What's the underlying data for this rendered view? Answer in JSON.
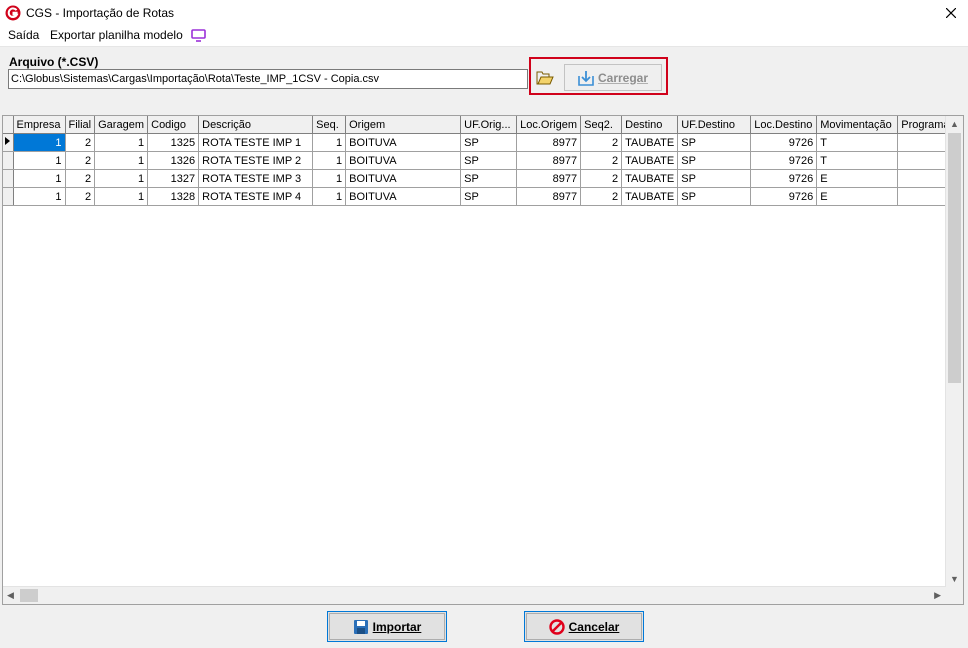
{
  "window": {
    "title": "CGS - Importação de Rotas"
  },
  "menu": {
    "items": [
      "Saída",
      "Exportar planilha modelo"
    ]
  },
  "file": {
    "label": "Arquivo (*.CSV)",
    "path": "C:\\Globus\\Sistemas\\Cargas\\Importação\\Rota\\Teste_IMP_1CSV - Copia.csv"
  },
  "load_button": {
    "label": "Carregar",
    "accent": "#d0021b"
  },
  "grid": {
    "columns": [
      "Empresa",
      "Filial",
      "Garagem",
      "Codigo",
      "Descrição",
      "Seq.",
      "Origem",
      "UF.Orig...",
      "Loc.Origem",
      "Seq2.",
      "Destino",
      "UF.Destino",
      "Loc.Destino",
      "Movimentação",
      "Programaç"
    ],
    "rows": [
      [
        "1",
        "2",
        "1",
        "1325",
        "ROTA TESTE IMP 1",
        "1",
        "BOITUVA",
        "SP",
        "8977",
        "2",
        "TAUBATE",
        "SP",
        "9726",
        "T",
        ""
      ],
      [
        "1",
        "2",
        "1",
        "1326",
        "ROTA TESTE IMP 2",
        "1",
        "BOITUVA",
        "SP",
        "8977",
        "2",
        "TAUBATE",
        "SP",
        "9726",
        "T",
        ""
      ],
      [
        "1",
        "2",
        "1",
        "1327",
        "ROTA TESTE IMP 3",
        "1",
        "BOITUVA",
        "SP",
        "8977",
        "2",
        "TAUBATE",
        "SP",
        "9726",
        "E",
        ""
      ],
      [
        "1",
        "2",
        "1",
        "1328",
        "ROTA TESTE IMP 4",
        "1",
        "BOITUVA",
        "SP",
        "8977",
        "2",
        "TAUBATE",
        "SP",
        "9726",
        "E",
        ""
      ]
    ]
  },
  "footer": {
    "import_label": "Importar",
    "cancel_label": "Cancelar"
  }
}
